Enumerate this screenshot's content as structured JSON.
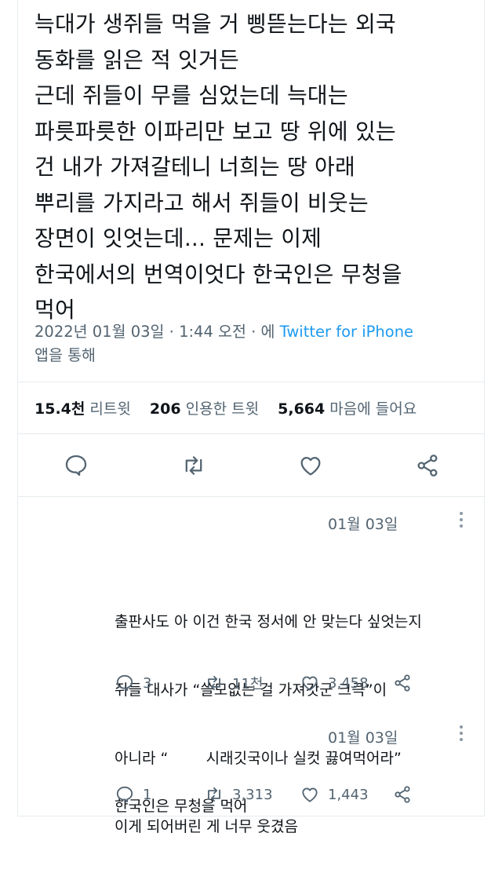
{
  "tweet": {
    "text_lines": [
      "늑대가 생쥐들 먹을 거 삥뜯는다는 외국",
      "동화를 읽은 적 잇거든",
      "근데 쥐들이 무를 심었는데 늑대는",
      "파릇파릇한 이파리만 보고 땅 위에 있는",
      "건 내가 가져갈테니 너희는 땅 아래",
      "뿌리를 가지라고 해서 쥐들이 비웃는",
      "장면이 잇엇는데... 문제는 이제",
      "한국에서의 번역이엇다 한국인은 무청을",
      "먹어"
    ],
    "timestamp": "2022년 01월 03일 · 1:44 오전 · 에",
    "source": "Twitter for iPhone",
    "via": "앱을 통해"
  },
  "stats": {
    "retweets_count": "15.4천",
    "retweets_label": "리트윗",
    "quotes_count": "206",
    "quotes_label": "인용한 트윗",
    "likes_count": "5,664",
    "likes_label": "마음에 들어요"
  },
  "actions": {
    "reply_icon": "reply-icon",
    "retweet_icon": "retweet-icon",
    "like_icon": "heart-icon",
    "share_icon": "share-icon"
  },
  "replies": [
    {
      "date": "01월 03일",
      "text_lines": [
        "출판사도 아 이건 한국 정서에 안 맞는다 싶엇는지",
        "쥐들 대사가 “쓸모없는 걸 가져갓군 크큭”이",
        "아니라 “        시래깃국이나 실컷 끓여먹어라”",
        "이게 되어버린 게 너무 웃겼음"
      ],
      "replies": "3",
      "retweets": "11천",
      "likes": "3,458"
    },
    {
      "date": "01월 03일",
      "text_lines": [
        "한국인은 무청을 먹어"
      ],
      "replies": "1",
      "retweets": "3,313",
      "likes": "1,443"
    }
  ],
  "colors": {
    "accent": "#1d9bf0",
    "muted": "#536471",
    "text": "#0f1419",
    "divider": "#e6ecf0"
  }
}
